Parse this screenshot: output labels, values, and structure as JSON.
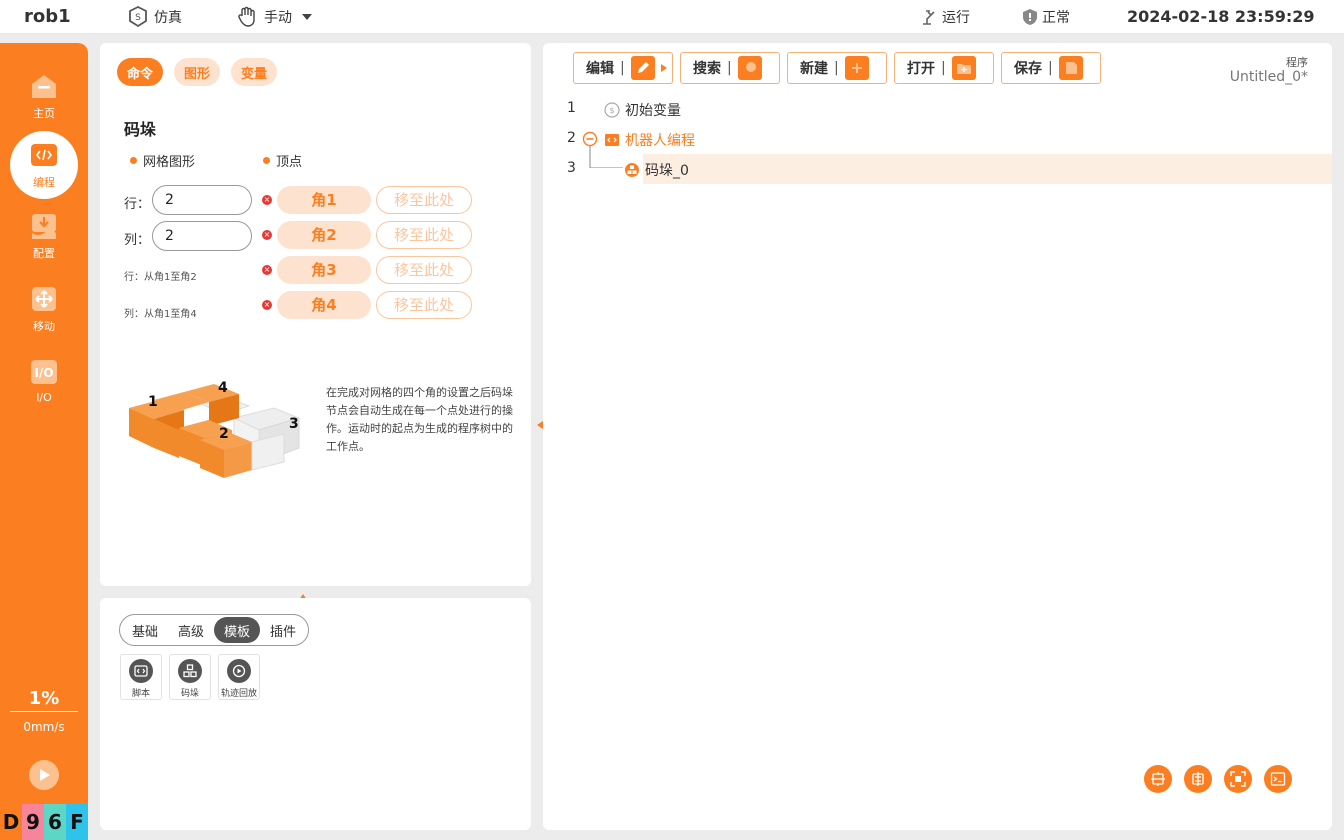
{
  "topbar": {
    "robot_name": "rob1",
    "mode_sim": "仿真",
    "mode_manual": "手动",
    "run_state": "运行",
    "health": "正常",
    "datetime": "2024-02-18 23:59:29"
  },
  "sidebar": {
    "items": [
      {
        "label": "主页",
        "icon": "home-icon"
      },
      {
        "label": "编程",
        "icon": "code-icon"
      },
      {
        "label": "配置",
        "icon": "download-icon"
      },
      {
        "label": "移动",
        "icon": "move-icon"
      },
      {
        "label": "I/O",
        "icon": "io-icon"
      }
    ],
    "speed_pct": "1%",
    "speed_mms": "0mm/s",
    "tags": [
      {
        "char": "D",
        "color": "#fb7f21"
      },
      {
        "char": "9",
        "color": "#f6849a"
      },
      {
        "char": "6",
        "color": "#5ed6c5"
      },
      {
        "char": "F",
        "color": "#2fc3ec"
      }
    ]
  },
  "palette": {
    "tabs": [
      "命令",
      "图形",
      "变量"
    ],
    "title": "码垛",
    "options": [
      "网格图形",
      "顶点"
    ],
    "row_label": "行：",
    "row_value": "2",
    "col_label": "列：",
    "col_value": "2",
    "hint_row": "行：从角1至角2",
    "hint_col": "列：从角1至角4",
    "corners": [
      "角1",
      "角2",
      "角3",
      "角4"
    ],
    "move_label": "移至此处",
    "diagram_labels": [
      "1",
      "2",
      "3",
      "4"
    ],
    "description": "在完成对网格的四个角的设置之后码垛节点会自动生成在每一个点处进行的操作。运动时的起点为生成的程序树中的工作点。"
  },
  "templates": {
    "segments": [
      "基础",
      "高级",
      "模板",
      "插件"
    ],
    "active_segment": "模板",
    "items": [
      {
        "label": "脚本",
        "icon": "script-icon"
      },
      {
        "label": "码垛",
        "icon": "pallet-icon"
      },
      {
        "label": "轨迹回放",
        "icon": "replay-icon"
      }
    ]
  },
  "program": {
    "toolbar": [
      "编辑",
      "搜索",
      "新建",
      "打开",
      "保存"
    ],
    "label": "程序",
    "name": "Untitled_0*",
    "rows": [
      {
        "line": "1",
        "text": "初始变量"
      },
      {
        "line": "2",
        "text": "机器人编程"
      },
      {
        "line": "3",
        "text": "码垛_0"
      }
    ]
  },
  "colors": {
    "accent": "#fb7f21",
    "accent_light": "#fde3cf",
    "selected_row": "#fdeee2"
  }
}
